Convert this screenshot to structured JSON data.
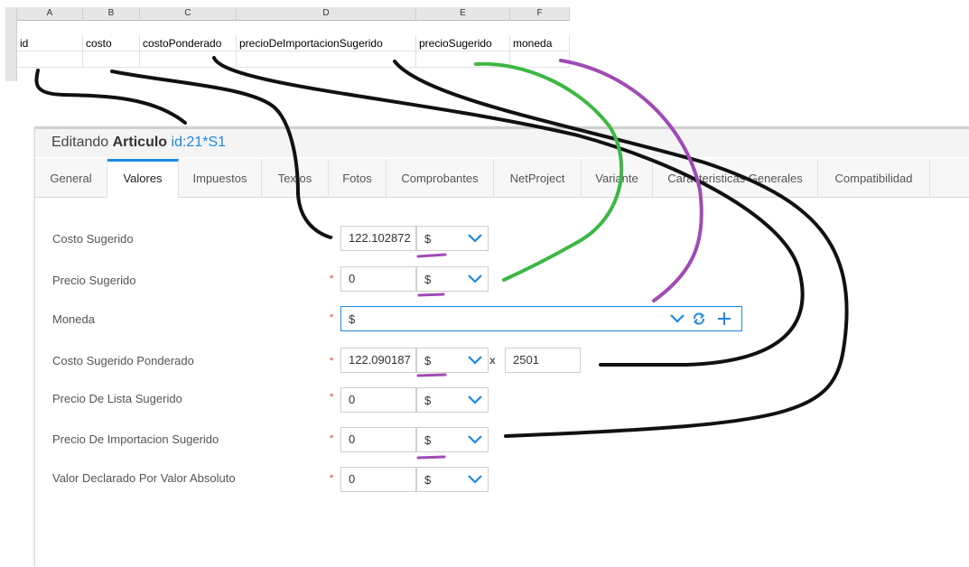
{
  "spreadsheet": {
    "columns": [
      "A",
      "B",
      "C",
      "D",
      "E",
      "F"
    ],
    "row1": [
      "id",
      "costo",
      "costoPonderado",
      "precioDeImportacionSugerido",
      "precioSugerido",
      "moneda"
    ]
  },
  "window": {
    "title_prefix": "Editando",
    "title_entity": "Articulo",
    "title_id": "id:21*S1"
  },
  "tabs": [
    "General",
    "Valores",
    "Impuestos",
    "Textos",
    "Fotos",
    "Comprobantes",
    "NetProject",
    "Variante",
    "Caracteristicas Generales",
    "Compatibilidad"
  ],
  "active_tab": "Valores",
  "fields": {
    "costo_sugerido": {
      "label": "Costo Sugerido",
      "value": "122.102872",
      "currency": "$"
    },
    "precio_sugerido": {
      "label": "Precio Sugerido",
      "value": "0",
      "currency": "$"
    },
    "moneda": {
      "label": "Moneda",
      "value": "$"
    },
    "costo_sugerido_ponderado": {
      "label": "Costo Sugerido Ponderado",
      "value": "122.090187",
      "currency": "$",
      "multiplier_symbol": "x",
      "quantity": "2501"
    },
    "precio_lista_sugerido": {
      "label": "Precio De Lista Sugerido",
      "value": "0",
      "currency": "$"
    },
    "precio_importacion_sugerido": {
      "label": "Precio De Importacion Sugerido",
      "value": "0",
      "currency": "$"
    },
    "valor_declarado": {
      "label": "Valor Declarado Por Valor Absoluto",
      "value": "0",
      "currency": "$"
    }
  },
  "required_mark": "*",
  "colors": {
    "accent": "#1e88e5",
    "required": "#e53935",
    "annotation_black": "#111111",
    "annotation_green": "#3cb843",
    "annotation_purple": "#a04bb5"
  }
}
